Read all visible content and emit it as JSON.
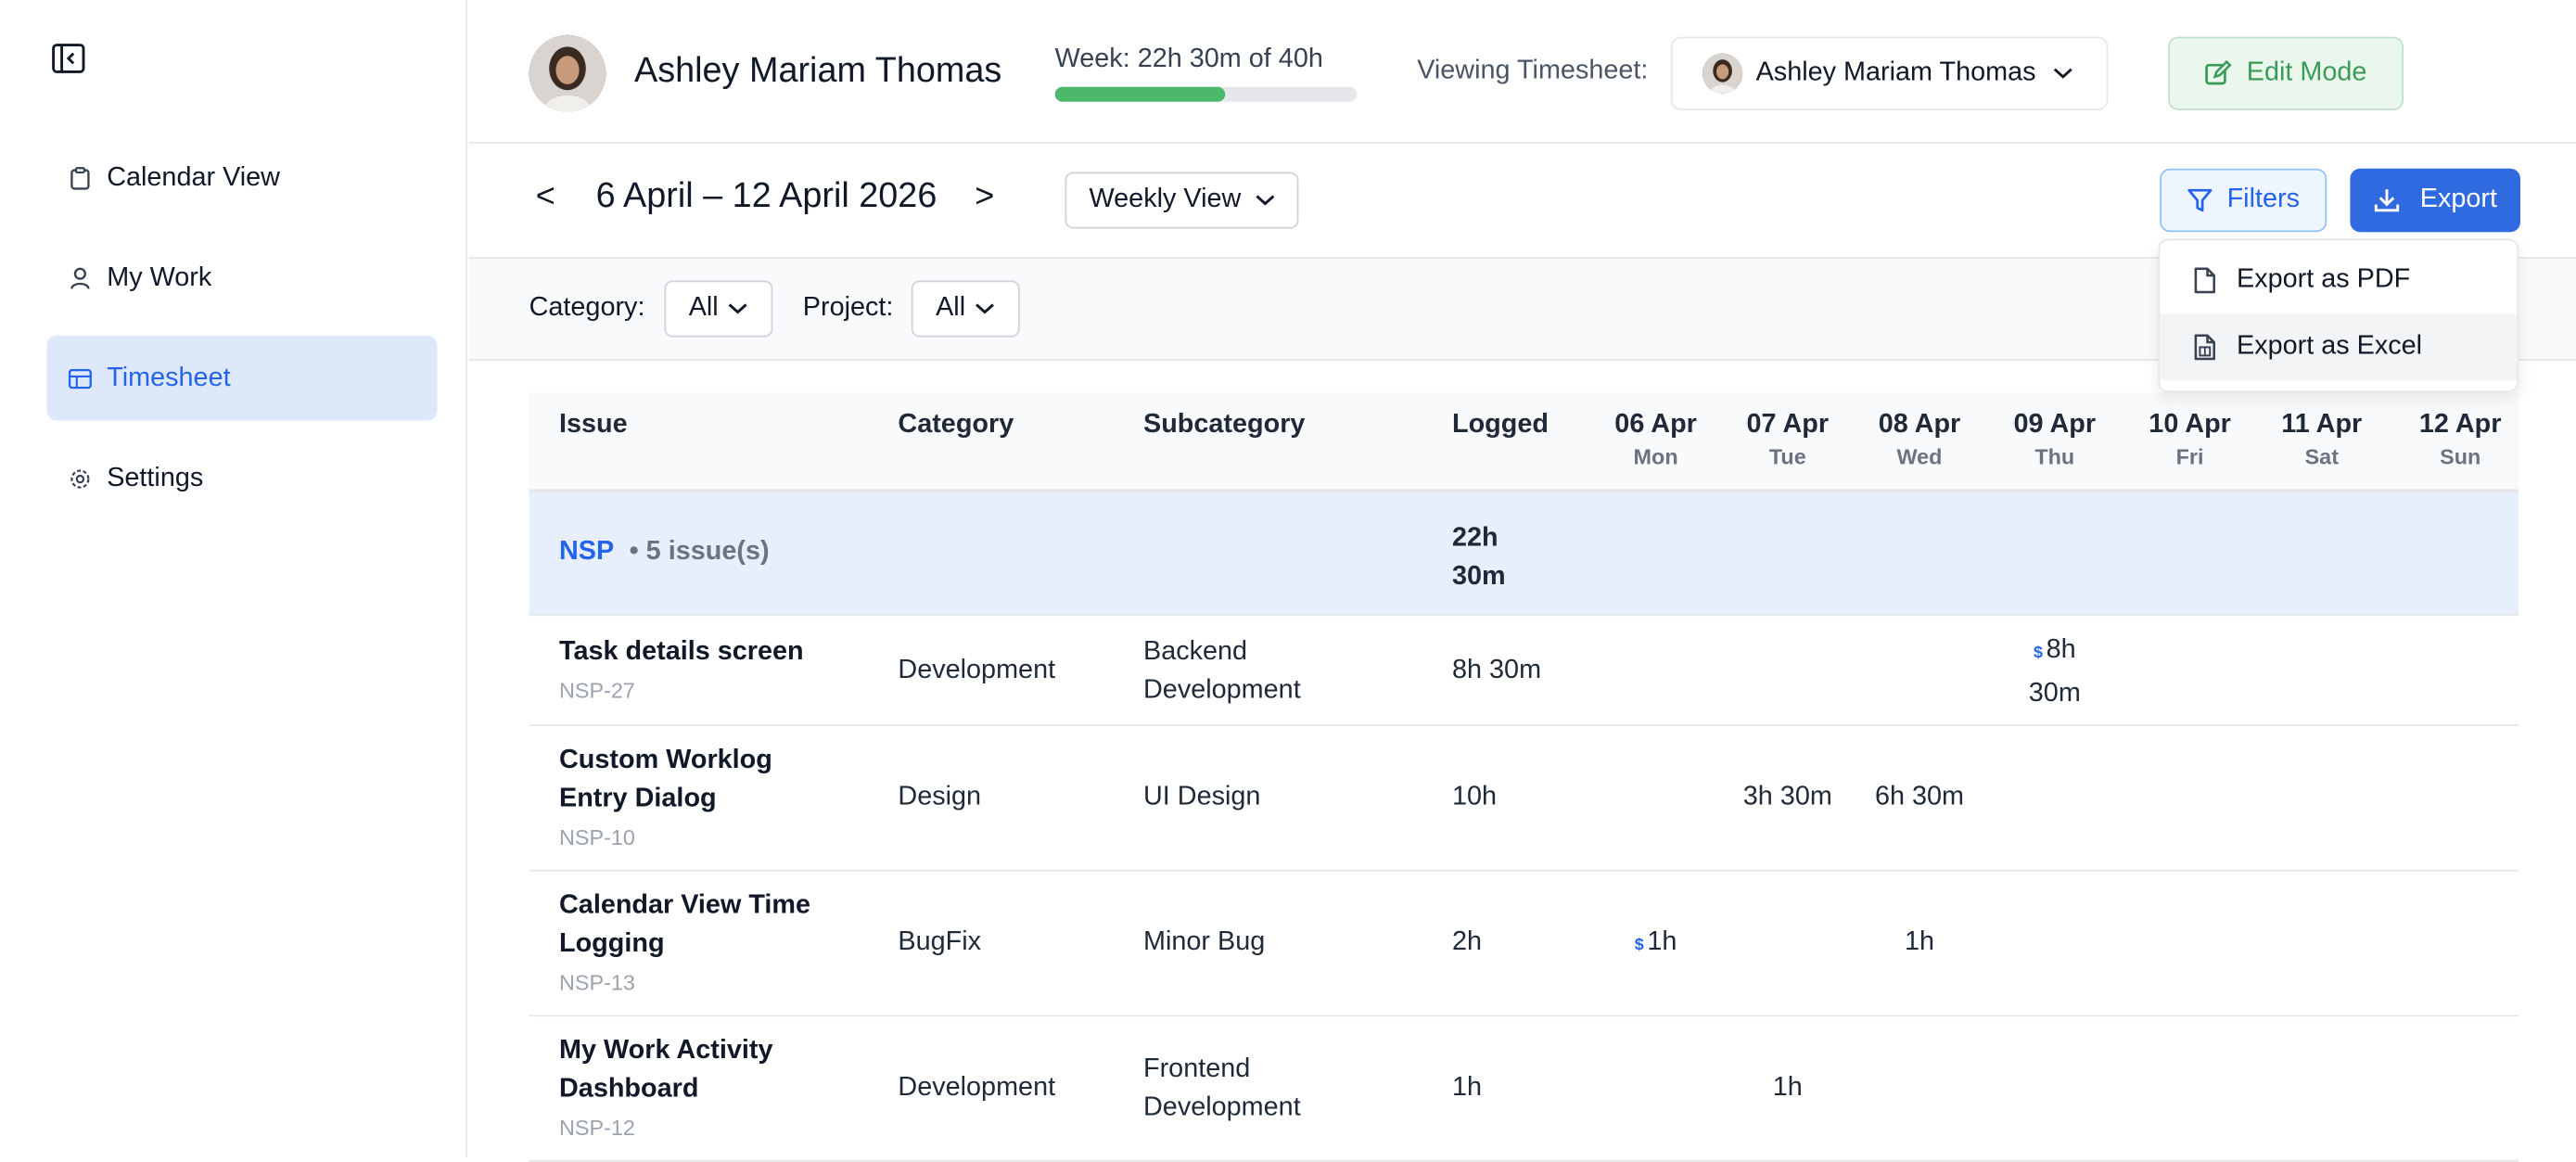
{
  "sidebar": {
    "items": [
      {
        "label": "Calendar View",
        "icon": "clipboard-icon"
      },
      {
        "label": "My Work",
        "icon": "user-icon"
      },
      {
        "label": "Timesheet",
        "icon": "table-icon"
      },
      {
        "label": "Settings",
        "icon": "gear-icon"
      }
    ],
    "active": "Timesheet"
  },
  "header": {
    "user_name": "Ashley Mariam Thomas",
    "week_label": "Week: 22h 30m of 40h",
    "week_progress": 0.5625,
    "viewing_label": "Viewing Timesheet:",
    "viewing_user": "Ashley Mariam Thomas",
    "edit_mode_label": "Edit Mode"
  },
  "toolbar": {
    "prev": "<",
    "next": ">",
    "date_range": "6 April – 12 April 2026",
    "view": "Weekly View",
    "filters_label": "Filters",
    "export_label": "Export"
  },
  "export_menu": {
    "pdf": "Export as PDF",
    "excel": "Export as Excel"
  },
  "filters": {
    "category_label": "Category:",
    "category_value": "All",
    "project_label": "Project:",
    "project_value": "All"
  },
  "table": {
    "headers": {
      "issue": "Issue",
      "category": "Category",
      "subcategory": "Subcategory",
      "logged": "Logged"
    },
    "days": [
      {
        "date": "06 Apr",
        "dow": "Mon"
      },
      {
        "date": "07 Apr",
        "dow": "Tue"
      },
      {
        "date": "08 Apr",
        "dow": "Wed"
      },
      {
        "date": "09 Apr",
        "dow": "Thu"
      },
      {
        "date": "10 Apr",
        "dow": "Fri"
      },
      {
        "date": "11 Apr",
        "dow": "Sat"
      },
      {
        "date": "12 Apr",
        "dow": "Sun"
      }
    ],
    "group": {
      "name": "NSP",
      "count": "• 5 issue(s)",
      "logged": "22h 30m"
    },
    "rows": [
      {
        "title": "Task details screen",
        "key": "NSP-27",
        "category": "Development",
        "subcategory": "Backend Development",
        "logged": "8h 30m",
        "thu": "8h 30m"
      },
      {
        "title": "Custom Worklog Entry Dialog",
        "key": "NSP-10",
        "category": "Design",
        "subcategory": "UI Design",
        "logged": "10h",
        "tue": "3h 30m",
        "wed": "6h 30m"
      },
      {
        "title": "Calendar View Time Logging",
        "key": "NSP-13",
        "category": "BugFix",
        "subcategory": "Minor Bug",
        "logged": "2h",
        "mon": "1h",
        "wed": "1h"
      },
      {
        "title": "My Work Activity Dashboard",
        "key": "NSP-12",
        "category": "Development",
        "subcategory": "Frontend Development",
        "logged": "1h",
        "tue": "1h"
      }
    ],
    "billable_symbol": "$"
  }
}
